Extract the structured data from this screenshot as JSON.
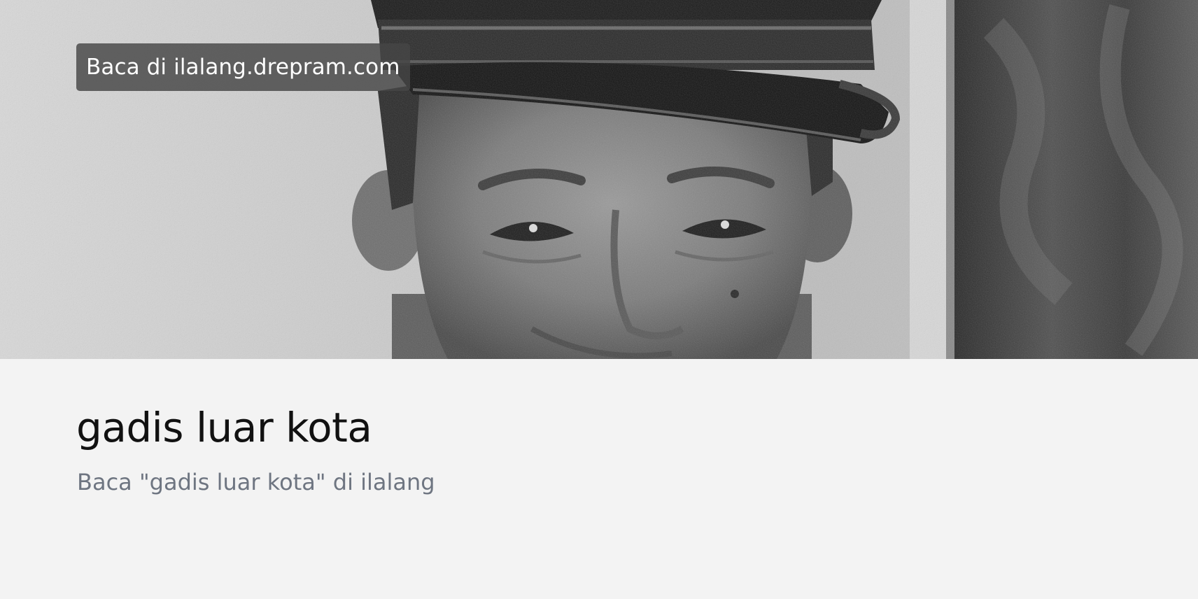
{
  "hero": {
    "image": "black-and-white-portrait-uniformed-man-with-cap",
    "source_label": "Baca di ilalang.drepram.com"
  },
  "article": {
    "title": "gadis luar kota",
    "subtitle": "Baca \"gadis luar kota\" di ilalang"
  },
  "colors": {
    "background": "#f3f3f3",
    "title": "#111111",
    "subtitle": "#6e7581",
    "badge_background": "#464646",
    "badge_text": "#ffffff"
  }
}
